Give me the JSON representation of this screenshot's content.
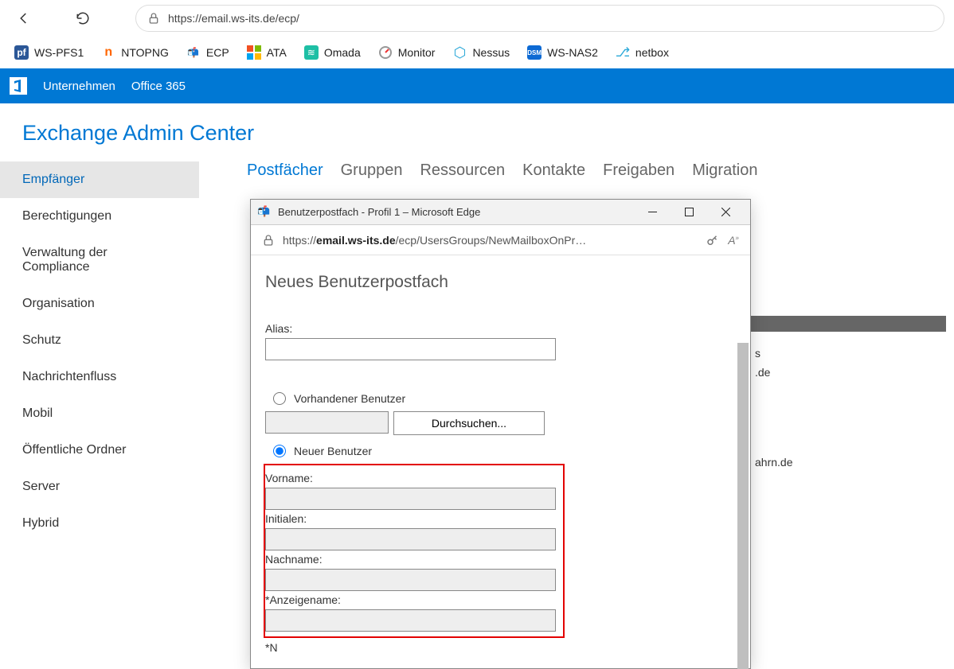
{
  "browser": {
    "url": "https://email.ws-its.de/ecp/"
  },
  "bookmarks": [
    {
      "icon": "pf",
      "label": "WS-PFS1",
      "bg": "#2b5797",
      "fg": "#fff"
    },
    {
      "icon": "n",
      "label": "NTOPNG",
      "bg": "#fff",
      "fg": "#f60"
    },
    {
      "icon": "📬",
      "label": "ECP",
      "bg": "",
      "fg": ""
    },
    {
      "icon": "⊞",
      "label": "ATA",
      "bg": "",
      "fg": ""
    },
    {
      "icon": "◆",
      "label": "Omada",
      "bg": "#1ebfa5",
      "fg": "#fff"
    },
    {
      "icon": "◐",
      "label": "Monitor",
      "bg": "",
      "fg": ""
    },
    {
      "icon": "⬡",
      "label": "Nessus",
      "bg": "",
      "fg": "#2aa8d8"
    },
    {
      "icon": "DSM",
      "label": "WS-NAS2",
      "bg": "#0d6ad4",
      "fg": "#fff"
    },
    {
      "icon": "⎇",
      "label": "netbox",
      "bg": "",
      "fg": "#2aa8d8"
    }
  ],
  "o365": {
    "company": "Unternehmen",
    "office": "Office 365"
  },
  "page_title": "Exchange Admin Center",
  "sidebar": {
    "items": [
      "Empfänger",
      "Berechtigungen",
      "Verwaltung der Compliance",
      "Organisation",
      "Schutz",
      "Nachrichtenfluss",
      "Mobil",
      "Öffentliche Ordner",
      "Server",
      "Hybrid"
    ]
  },
  "tabs": [
    "Postfächer",
    "Gruppen",
    "Ressourcen",
    "Kontakte",
    "Freigaben",
    "Migration"
  ],
  "background_hints": {
    "a": "s",
    "b": ".de",
    "c": "ahrn.de"
  },
  "popup": {
    "window_title": "Benutzerpostfach - Profil 1 – Microsoft Edge",
    "url_prefix": "https://",
    "url_bold": "email.ws-its.de",
    "url_rest": "/ecp/UsersGroups/NewMailboxOnPr…",
    "heading": "Neues Benutzerpostfach",
    "alias_label": "Alias:",
    "existing_user_label": "Vorhandener Benutzer",
    "browse_btn": "Durchsuchen...",
    "new_user_label": "Neuer Benutzer",
    "vorname_label": "Vorname:",
    "initialen_label": "Initialen:",
    "nachname_label": "Nachname:",
    "anzeigename_label": "*Anzeigename:",
    "name_cut": "*N"
  }
}
